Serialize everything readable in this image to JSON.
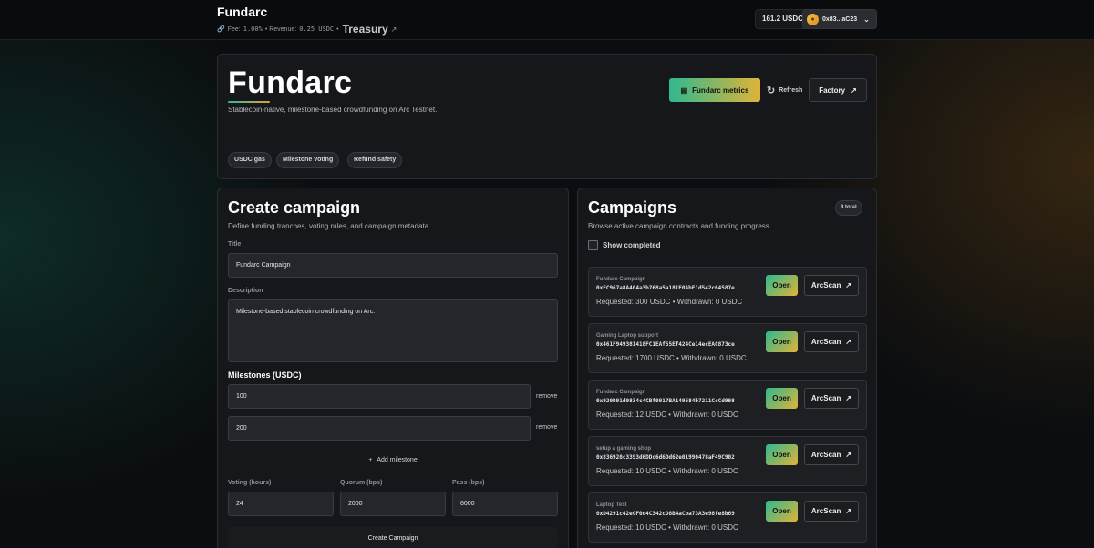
{
  "topbar": {
    "brand": "Fundarc",
    "fee_label": "Fee:",
    "fee_value": "1.00%",
    "revenue_label": "• Revenue:",
    "revenue_value": "0.25 USDC",
    "treasury_sep": "•",
    "treasury_label": "Treasury",
    "balance": "161.2 USDC",
    "wallet_address": "0x83...aC23"
  },
  "hero": {
    "title": "Fundarc",
    "description": "Stablecoin-native, milestone-based crowdfunding on Arc Testnet.",
    "pills": [
      "USDC gas",
      "Milestone voting",
      "Refund safety"
    ],
    "metrics_button": "Fundarc metrics",
    "refresh_button": "Refresh",
    "factory_button": "Factory"
  },
  "create": {
    "title": "Create campaign",
    "description": "Define funding tranches, voting rules, and campaign metadata.",
    "title_label": "Title",
    "title_value": "Fundarc Campaign",
    "description_label": "Description",
    "description_value": "Milestone-based stablecoin crowdfunding on Arc.",
    "milestones_heading": "Milestones (USDC)",
    "milestones": [
      {
        "value": "100",
        "remove_label": "remove"
      },
      {
        "value": "200",
        "remove_label": "remove"
      }
    ],
    "add_milestone": "Add milestone",
    "voting_label": "Voting (hours)",
    "voting_value": "24",
    "quorum_label": "Quorum (bps)",
    "quorum_value": "2000",
    "pass_label": "Pass (bps)",
    "pass_value": "6000",
    "submit_button": "Create Campaign"
  },
  "campaigns": {
    "title": "Campaigns",
    "description": "Browse active campaign contracts and funding progress.",
    "count_badge": "8 total",
    "show_completed_label": "Show completed",
    "open_label": "Open",
    "arcscan_label": "ArcScan",
    "items": [
      {
        "name": "Fundarc Campaign",
        "address": "0xFC967a8A404a3b768a5a181E0AbE1d542c64587e",
        "stats": "Requested: 300 USDC • Withdrawn: 0 USDC"
      },
      {
        "name": "Gaming Laptop support",
        "address": "0x461F949381418FC1EAf55Ef424Ce14ecEAC873ce",
        "stats": "Requested: 1700 USDC • Withdrawn: 0 USDC"
      },
      {
        "name": "Fundarc Campaign",
        "address": "0x920D91d0834c4CBf0917BA149684b7211CcCd998",
        "stats": "Requested: 12 USDC • Withdrawn: 0 USDC"
      },
      {
        "name": "setup a gaming shop",
        "address": "0x836920c3393d6DDc6d6Dd62e01990478aF49C902",
        "stats": "Requested: 10 USDC • Withdrawn: 0 USDC"
      },
      {
        "name": "Laptop Test",
        "address": "0xD4291c42eCF0d4C342cD8B4aCba73A3e98fe8b69",
        "stats": "Requested: 10 USDC • Withdrawn: 0 USDC"
      }
    ]
  }
}
